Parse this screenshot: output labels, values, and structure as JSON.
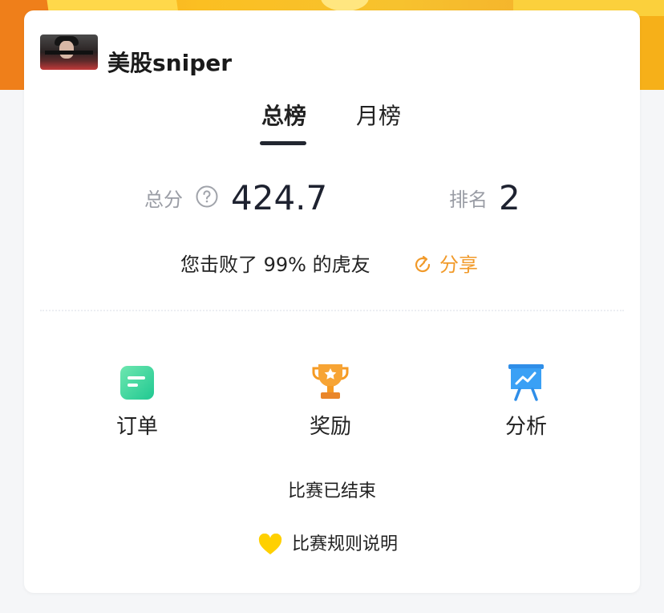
{
  "user": {
    "name": "美股sniper"
  },
  "tabs": [
    {
      "label": "总榜",
      "active": true
    },
    {
      "label": "月榜",
      "active": false
    }
  ],
  "stats": {
    "score_label": "总分",
    "score_value": "424.7",
    "rank_label": "排名",
    "rank_value": "2"
  },
  "beat_text": "您击败了 99% 的虎友",
  "share_label": "分享",
  "features": [
    {
      "label": "订单",
      "icon": "order-icon"
    },
    {
      "label": "奖励",
      "icon": "trophy-icon"
    },
    {
      "label": "分析",
      "icon": "chart-board-icon"
    }
  ],
  "status_text": "比赛已结束",
  "rules_label": "比赛规则说明",
  "colors": {
    "accent_orange": "#f19a2a",
    "order_green": "#3fd6a0",
    "trophy_orange": "#f59a23",
    "analysis_blue": "#3aa0f5",
    "heart_yellow": "#ffd000"
  }
}
